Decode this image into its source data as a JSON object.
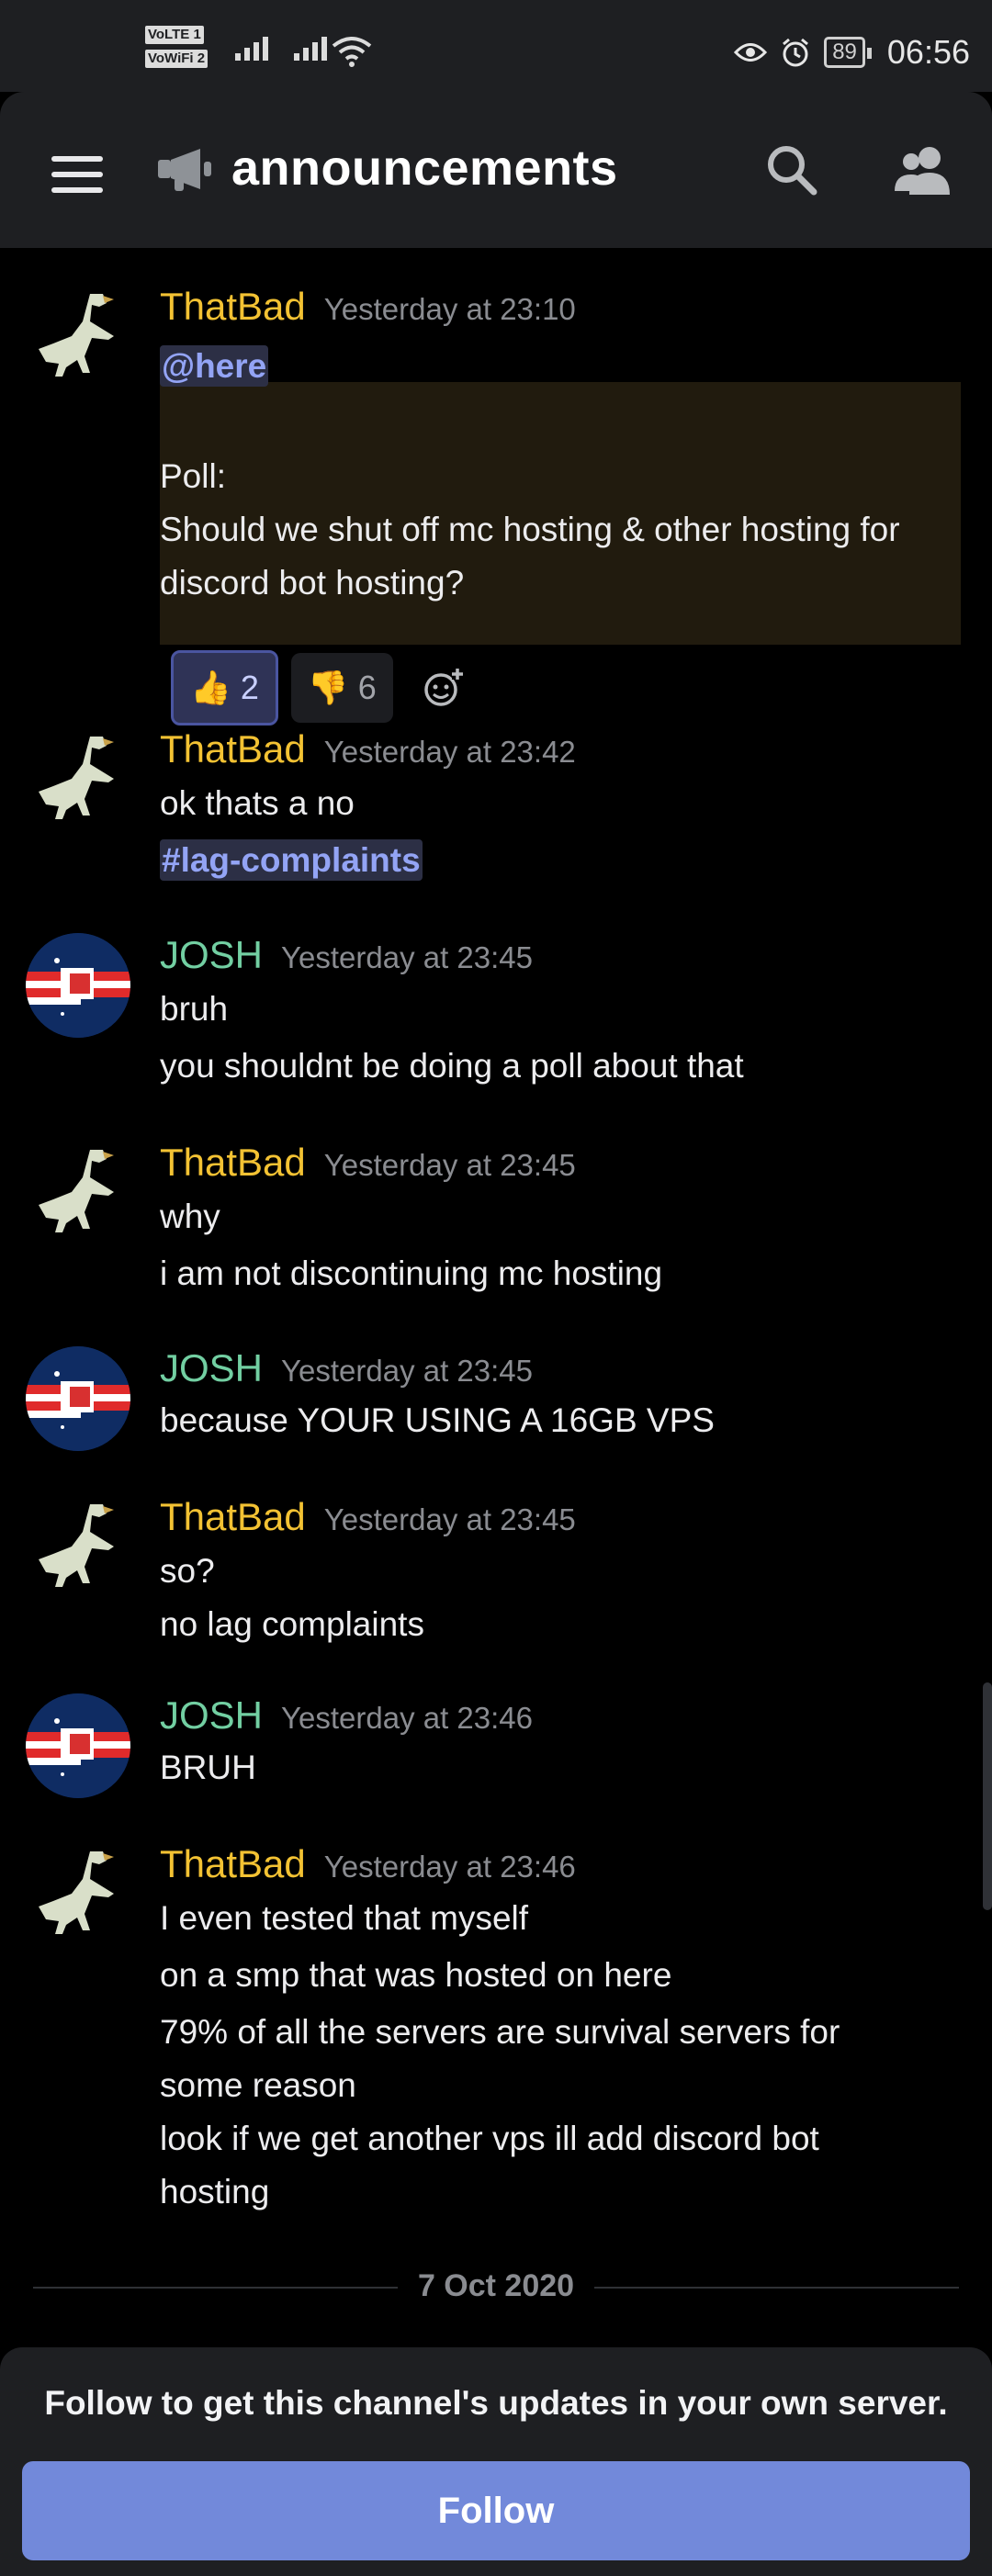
{
  "status_bar": {
    "network_labels": [
      "VoLTE 1",
      "VoWiFi 2"
    ],
    "battery": "89",
    "time": "06:56"
  },
  "header": {
    "channel_name": "announcements"
  },
  "messages": [
    {
      "author": "ThatBad",
      "timestamp": "Yesterday at 23:10",
      "lines": [
        "@here",
        "Poll:",
        "Should we shut off mc hosting & other hosting for",
        "discord bot hosting?"
      ],
      "reactions": [
        {
          "emoji": "👍",
          "count": "2",
          "active": true
        },
        {
          "emoji": "👎",
          "count": "6",
          "active": false
        }
      ]
    },
    {
      "author": "ThatBad",
      "timestamp": "Yesterday at 23:42",
      "lines": [
        "ok thats a no",
        "#lag-complaints"
      ]
    },
    {
      "author": "JOSH",
      "timestamp": "Yesterday at 23:45",
      "lines": [
        "bruh",
        "you shouldnt be doing a poll about that"
      ]
    },
    {
      "author": "ThatBad",
      "timestamp": "Yesterday at 23:45",
      "lines": [
        "why",
        "i am not discontinuing mc hosting"
      ]
    },
    {
      "author": "JOSH",
      "timestamp": "Yesterday at 23:45",
      "lines": [
        "because YOUR USING A 16GB VPS"
      ]
    },
    {
      "author": "ThatBad",
      "timestamp": "Yesterday at 23:45",
      "lines": [
        "so?",
        "no lag complaints"
      ]
    },
    {
      "author": "JOSH",
      "timestamp": "Yesterday at 23:46",
      "lines": [
        "BRUH"
      ]
    },
    {
      "author": "ThatBad",
      "timestamp": "Yesterday at 23:46",
      "lines": [
        "I even tested that myself",
        "on a smp that was hosted on here",
        "79% of all the servers are survival servers for",
        "some reason",
        "look if we get another vps ill add discord bot",
        "hosting"
      ]
    }
  ],
  "date_divider": "7 Oct 2020",
  "follow": {
    "prompt": "Follow to get this channel's updates in your own server.",
    "button_label": "Follow"
  },
  "colors": {
    "background": "#000000",
    "header": "#1e1f22",
    "thatbad_name": "#f3c233",
    "josh_name": "#72cfa2",
    "mention": "#93a4f5",
    "follow_button": "#7289da"
  }
}
